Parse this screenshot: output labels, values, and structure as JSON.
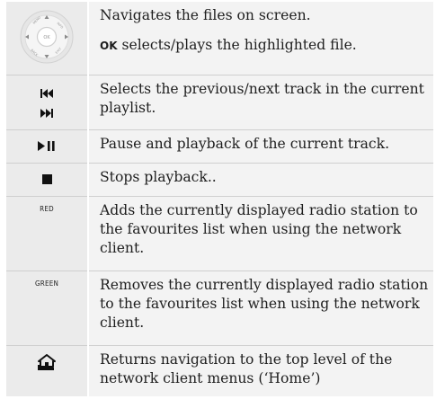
{
  "rows": [
    {
      "icon": "navigation-dial-icon",
      "icon_label": "OK",
      "text": "Navigates the files on screen.",
      "text2_key": "OK",
      "text2": " selects/plays the highlighted file."
    },
    {
      "icon": "skip-prev-next-icon",
      "icon_glyph_prev": "⏮",
      "icon_glyph_next": "⏭",
      "text": "Selects the previous/next track in the current playlist."
    },
    {
      "icon": "play-pause-icon",
      "icon_glyph": "▶❚❚",
      "text": "Pause and playback of the current track."
    },
    {
      "icon": "stop-icon",
      "icon_glyph": "■",
      "text": "Stops playback.."
    },
    {
      "icon_label": "RED",
      "text": "Adds the currently displayed radio station to the favourites list when using the network client."
    },
    {
      "icon_label": "GREEN",
      "text": "Removes the currently displayed radio station to the favourites list when using the network client."
    },
    {
      "icon": "home-icon",
      "text": "Returns navigation to the top level of the network client menus (‘Home’)"
    }
  ]
}
